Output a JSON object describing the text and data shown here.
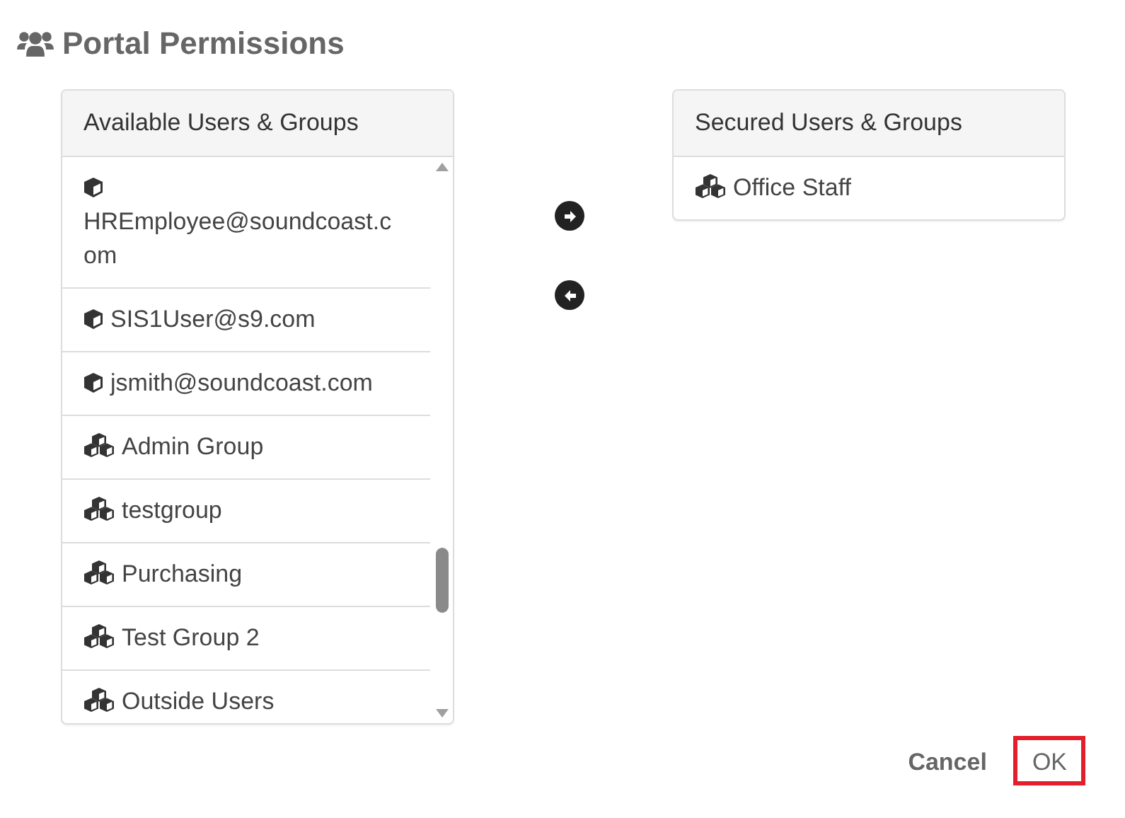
{
  "title": "Portal Permissions",
  "available": {
    "heading": "Available Users & Groups",
    "items": [
      {
        "kind": "user",
        "label": "HREmployee@soundcoast.com"
      },
      {
        "kind": "user",
        "label": "SIS1User@s9.com"
      },
      {
        "kind": "user",
        "label": "jsmith@soundcoast.com"
      },
      {
        "kind": "group",
        "label": "Admin Group"
      },
      {
        "kind": "group",
        "label": "testgroup"
      },
      {
        "kind": "group",
        "label": "Purchasing"
      },
      {
        "kind": "group",
        "label": "Test Group 2"
      },
      {
        "kind": "group",
        "label": "Outside Users"
      }
    ]
  },
  "move_buttons": [
    {
      "kind": "add"
    },
    {
      "kind": "remove"
    }
  ],
  "secured": {
    "heading": "Secured Users & Groups",
    "items": [
      {
        "kind": "group",
        "label": "Office Staff"
      }
    ]
  },
  "buttons": [
    {
      "kind": "cancel",
      "label": "Cancel",
      "highlighted": false
    },
    {
      "kind": "ok",
      "label": "OK",
      "highlighted": true
    }
  ]
}
